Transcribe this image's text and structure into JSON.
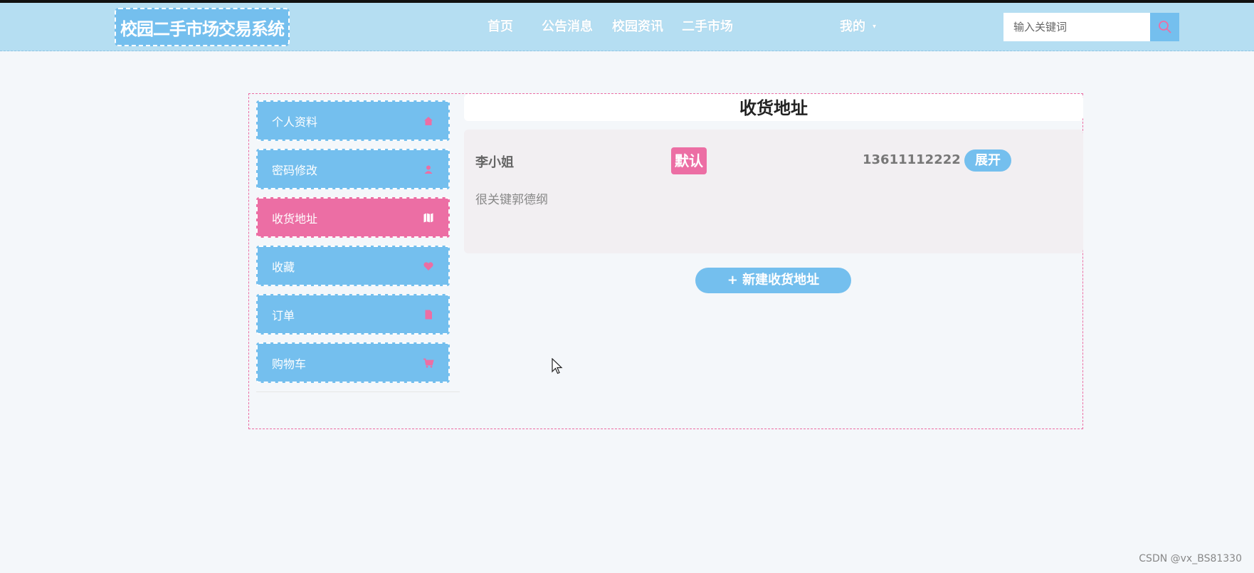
{
  "header": {
    "brand": "校园二手市场交易系统",
    "nav": [
      "首页",
      "公告消息",
      "校园资讯",
      "二手市场"
    ],
    "my_label": "我的",
    "search": {
      "placeholder": "输入关键词",
      "value": ""
    }
  },
  "sidebar": {
    "items": [
      {
        "label": "个人资料",
        "icon": "home-icon"
      },
      {
        "label": "密码修改",
        "icon": "user-icon"
      },
      {
        "label": "收货地址",
        "icon": "map-icon",
        "active": true
      },
      {
        "label": "收藏",
        "icon": "heart-icon"
      },
      {
        "label": "订单",
        "icon": "file-icon"
      },
      {
        "label": "购物车",
        "icon": "cart-icon"
      }
    ]
  },
  "main": {
    "title": "收货地址",
    "addresses": [
      {
        "name": "李小姐",
        "default_badge": "默认",
        "phone": "13611112222",
        "expand_label": "展开",
        "detail": "很关键郭德纲"
      }
    ],
    "new_address_label": "+ 新建收货地址"
  },
  "watermark": "CSDN @vx_BS81330",
  "colors": {
    "header_bg": "#b5def2",
    "primary_blue": "#74bfee",
    "accent_pink": "#ec6ea4",
    "page_bg": "#f4f7fa"
  }
}
